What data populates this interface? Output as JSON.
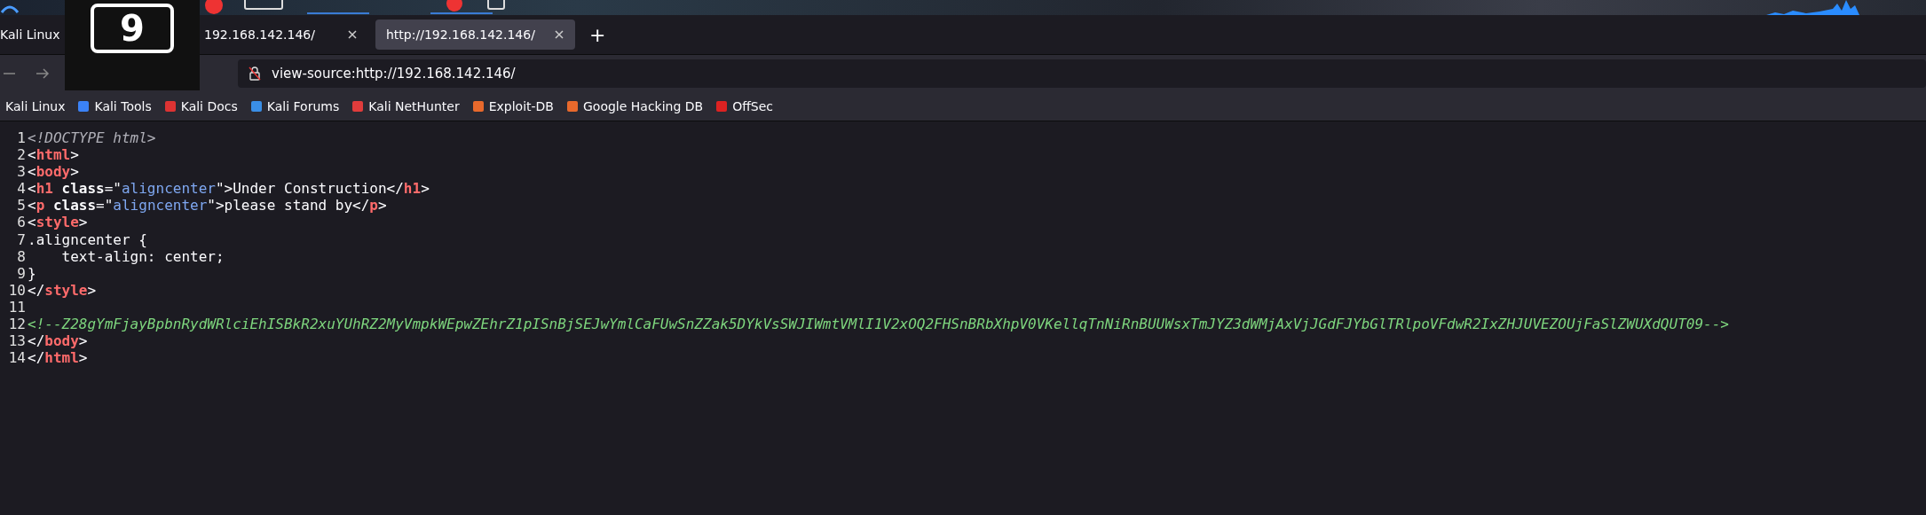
{
  "workspace_overlay": {
    "number": "9"
  },
  "tabs": [
    {
      "title": "Kali Linux",
      "selected": false
    },
    {
      "title": "192.168.142.146/",
      "selected": false
    },
    {
      "title": "http://192.168.142.146/",
      "selected": true
    }
  ],
  "new_tab": "+",
  "address_bar": {
    "value": "view-source:http://192.168.142.146/"
  },
  "bookmarks": [
    {
      "label": "Kali Linux"
    },
    {
      "label": "Kali Tools"
    },
    {
      "label": "Kali Docs"
    },
    {
      "label": "Kali Forums"
    },
    {
      "label": "Kali NetHunter"
    },
    {
      "label": "Exploit-DB"
    },
    {
      "label": "Google Hacking DB"
    },
    {
      "label": "OffSec"
    }
  ],
  "source_lines": [
    {
      "number": "1",
      "tokens": [
        {
          "kind": "doctype",
          "text": "<!DOCTYPE html>"
        }
      ]
    },
    {
      "number": "2",
      "tokens": [
        {
          "kind": "punct",
          "text": "<"
        },
        {
          "kind": "tag",
          "text": "html"
        },
        {
          "kind": "punct",
          "text": ">"
        }
      ]
    },
    {
      "number": "3",
      "tokens": [
        {
          "kind": "punct",
          "text": "<"
        },
        {
          "kind": "tag",
          "text": "body"
        },
        {
          "kind": "punct",
          "text": ">"
        }
      ]
    },
    {
      "number": "4",
      "tokens": [
        {
          "kind": "punct",
          "text": "<"
        },
        {
          "kind": "tag",
          "text": "h1"
        },
        {
          "kind": "attr",
          "text": " class"
        },
        {
          "kind": "punct",
          "text": "=\""
        },
        {
          "kind": "value",
          "text": "aligncenter"
        },
        {
          "kind": "punct",
          "text": "\">Under Construction</"
        },
        {
          "kind": "tag",
          "text": "h1"
        },
        {
          "kind": "punct",
          "text": ">"
        }
      ]
    },
    {
      "number": "5",
      "tokens": [
        {
          "kind": "punct",
          "text": "<"
        },
        {
          "kind": "tag",
          "text": "p"
        },
        {
          "kind": "attr",
          "text": " class"
        },
        {
          "kind": "punct",
          "text": "=\""
        },
        {
          "kind": "value",
          "text": "aligncenter"
        },
        {
          "kind": "punct",
          "text": "\">please stand by</"
        },
        {
          "kind": "tag",
          "text": "p"
        },
        {
          "kind": "punct",
          "text": ">"
        }
      ]
    },
    {
      "number": "6",
      "tokens": [
        {
          "kind": "punct",
          "text": "<"
        },
        {
          "kind": "tag",
          "text": "style"
        },
        {
          "kind": "punct",
          "text": ">"
        }
      ]
    },
    {
      "number": "7",
      "tokens": [
        {
          "kind": "punct",
          "text": ".aligncenter {"
        }
      ]
    },
    {
      "number": "8",
      "tokens": [
        {
          "kind": "punct",
          "text": "    text-align: center;"
        }
      ]
    },
    {
      "number": "9",
      "tokens": [
        {
          "kind": "punct",
          "text": "}"
        }
      ]
    },
    {
      "number": "10",
      "tokens": [
        {
          "kind": "punct",
          "text": "</"
        },
        {
          "kind": "tag",
          "text": "style"
        },
        {
          "kind": "punct",
          "text": ">"
        }
      ]
    },
    {
      "number": "11"
    },
    {
      "number": "12",
      "tokens": [
        {
          "kind": "comment",
          "text": "<!--Z28gYmFjayBpbnRydWRlciEhISBkR2xuYUhRZ2MyVmpkWEpwZEhrZ1pISnBjSEJwYmlCaFUwSnZZak5DYkVsSWJIWmtVMlI1V2xOQ2FHSnBRbXhpV0VKellqTnNiRnBUUWsxTmJYZ3dWMjAxVjJGdFJYbGlTRlpoVFdwR2IxZHJUVEZOUjFaSlZWUXdQUT09-->"
        }
      ]
    },
    {
      "number": "13",
      "tokens": [
        {
          "kind": "punct",
          "text": "</"
        },
        {
          "kind": "tag",
          "text": "body"
        },
        {
          "kind": "punct",
          "text": ">"
        }
      ]
    },
    {
      "number": "14",
      "tokens": [
        {
          "kind": "punct",
          "text": "</"
        },
        {
          "kind": "tag",
          "text": "html"
        },
        {
          "kind": "punct",
          "text": ">"
        }
      ]
    }
  ]
}
